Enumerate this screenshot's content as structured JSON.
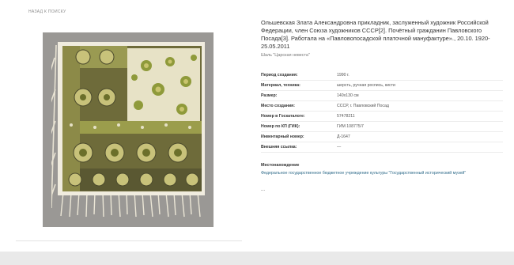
{
  "nav": {
    "back_label": "НАЗАД К ПОИСКУ"
  },
  "object": {
    "author_title": "Ольшевская Злата Александровна прикладник, заслуженный художник Российской Федерации, член Союза художников СССР[2]. Почётный гражданин Павловского Посада[3]. Работала на «Павловопосадской платочной мануфактуре»., 20.10. 1920-25.05.2011",
    "name": "Шаль \"Царская невеста\"",
    "image_alt": "Шаль \"Царская невеста\""
  },
  "attributes": [
    {
      "label": "Период создания:",
      "value": "1990 г."
    },
    {
      "label": "Материал, техника:",
      "value": "шерсть, ручная роспись, кисти"
    },
    {
      "label": "Размер:",
      "value": "140x130 см"
    },
    {
      "label": "Место создания:",
      "value": "СССР, г. Павловский Посад"
    },
    {
      "label": "Номер в Госкаталоге:",
      "value": "57478211"
    },
    {
      "label": "Номер по КП (ГИК):",
      "value": "ГИМ 108775/7"
    },
    {
      "label": "Инвентарный номер:",
      "value": "Д-1647"
    },
    {
      "label": "Внешняя ссылка:",
      "value": "—"
    }
  ],
  "location": {
    "title": "Местонахождение",
    "museum": "Федеральное государственное бюджетное учреждение культуры \"Государственный исторический музей\""
  },
  "more": "...",
  "colors": {
    "link": "#2f6b8a",
    "shawl_olive": "#8c8a3a",
    "shawl_dark": "#4b4a2c",
    "shawl_cream": "#ece6cf"
  }
}
